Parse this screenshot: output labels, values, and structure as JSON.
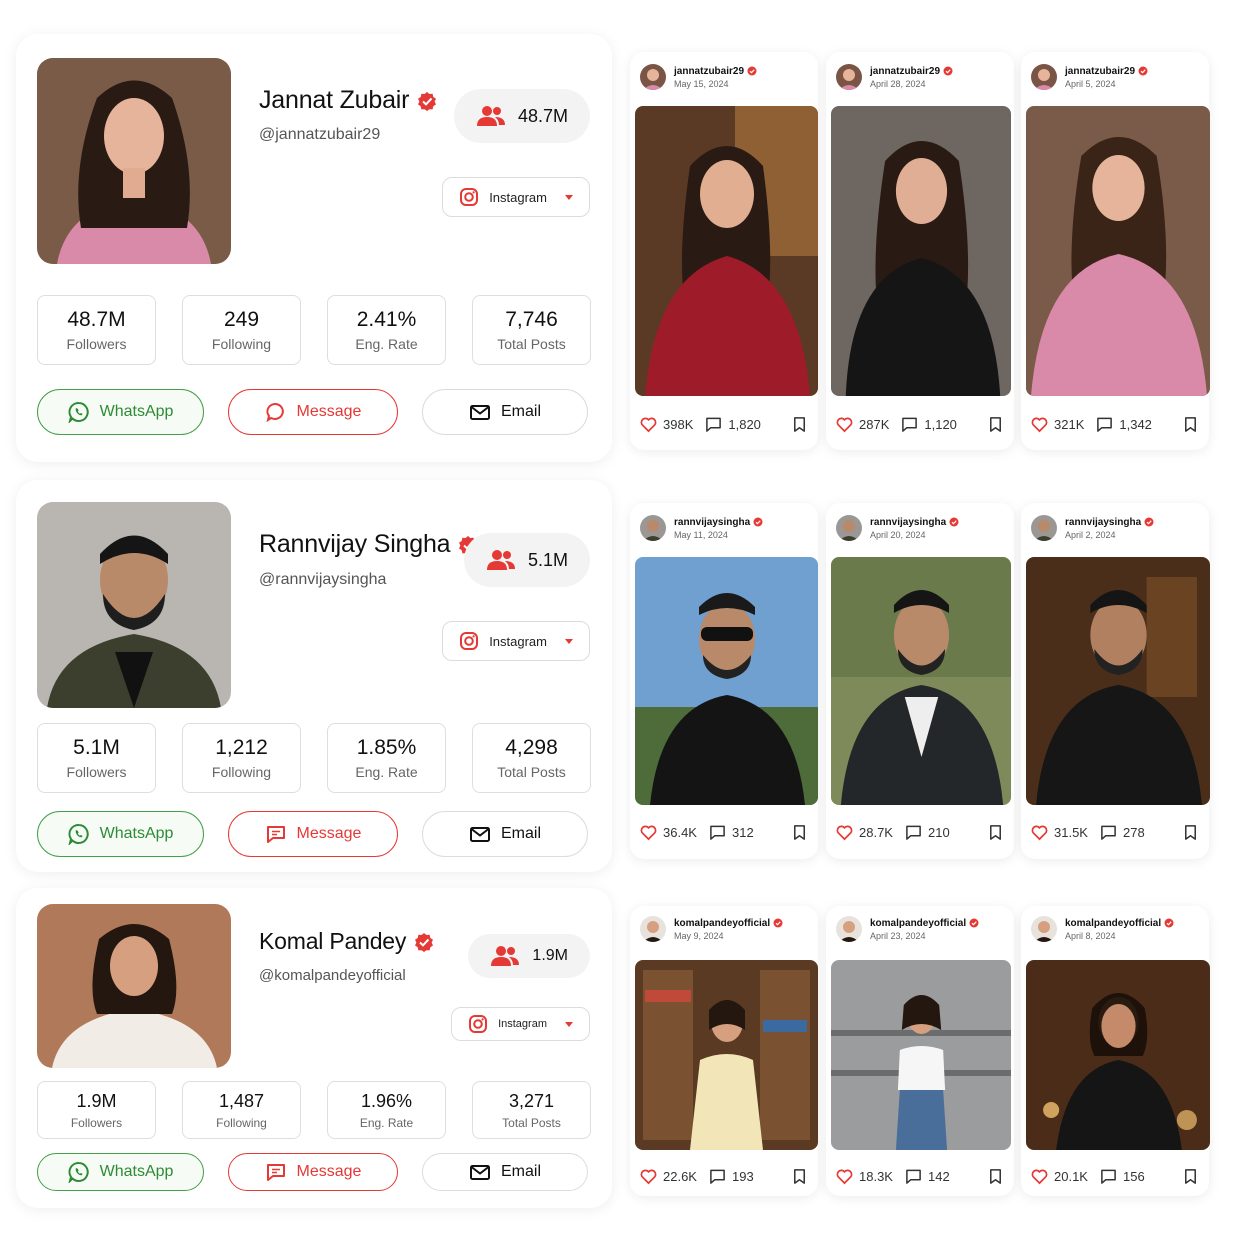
{
  "profiles": [
    {
      "name": "Jannat Zubair",
      "handle": "@jannatzubair29",
      "followers_pill": "48.7M",
      "platform": "Instagram",
      "stats": [
        {
          "value": "48.7M",
          "label": "Followers"
        },
        {
          "value": "249",
          "label": "Following"
        },
        {
          "value": "2.41%",
          "label": "Eng. Rate"
        },
        {
          "value": "7,746",
          "label": "Total Posts"
        }
      ],
      "actions": {
        "whatsapp": "WhatsApp",
        "message": "Message",
        "email": "Email"
      },
      "posts": [
        {
          "user": "jannatzubair29",
          "date": "May 15, 2024",
          "likes": "398K",
          "comments": "1,820"
        },
        {
          "user": "jannatzubair29",
          "date": "April 28, 2024",
          "likes": "287K",
          "comments": "1,120"
        },
        {
          "user": "jannatzubair29",
          "date": "April 5, 2024",
          "likes": "321K",
          "comments": "1,342"
        }
      ]
    },
    {
      "name": "Rannvijay Singha",
      "handle": "@rannvijaysingha",
      "followers_pill": "5.1M",
      "platform": "Instagram",
      "stats": [
        {
          "value": "5.1M",
          "label": "Followers"
        },
        {
          "value": "1,212",
          "label": "Following"
        },
        {
          "value": "1.85%",
          "label": "Eng. Rate"
        },
        {
          "value": "4,298",
          "label": "Total Posts"
        }
      ],
      "actions": {
        "whatsapp": "WhatsApp",
        "message": "Message",
        "email": "Email"
      },
      "posts": [
        {
          "user": "rannvijaysingha",
          "date": "May 11, 2024",
          "likes": "36.4K",
          "comments": "312"
        },
        {
          "user": "rannvijaysingha",
          "date": "April 20, 2024",
          "likes": "28.7K",
          "comments": "210"
        },
        {
          "user": "rannvijaysingha",
          "date": "April 2, 2024",
          "likes": "31.5K",
          "comments": "278"
        }
      ]
    },
    {
      "name": "Komal Pandey",
      "handle": "@komalpandeyofficial",
      "followers_pill": "1.9M",
      "platform": "Instagram",
      "stats": [
        {
          "value": "1.9M",
          "label": "Followers"
        },
        {
          "value": "1,487",
          "label": "Following"
        },
        {
          "value": "1.96%",
          "label": "Eng. Rate"
        },
        {
          "value": "3,271",
          "label": "Total Posts"
        }
      ],
      "actions": {
        "whatsapp": "WhatsApp",
        "message": "Message",
        "email": "Email"
      },
      "posts": [
        {
          "user": "komalpandeyofficial",
          "date": "May 9, 2024",
          "likes": "22.6K",
          "comments": "193"
        },
        {
          "user": "komalpandeyofficial",
          "date": "April 23, 2024",
          "likes": "18.3K",
          "comments": "142"
        },
        {
          "user": "komalpandeyofficial",
          "date": "April 8, 2024",
          "likes": "20.1K",
          "comments": "156"
        }
      ]
    }
  ],
  "colors": {
    "accent": "#e53935",
    "whatsapp": "#2e8b35",
    "verified": "#e53935"
  },
  "icons": [
    "verified-badge-icon",
    "users-icon",
    "instagram-icon",
    "chevron-down-icon",
    "whatsapp-icon",
    "message-icon",
    "email-icon",
    "heart-icon",
    "comment-icon",
    "bookmark-icon"
  ]
}
